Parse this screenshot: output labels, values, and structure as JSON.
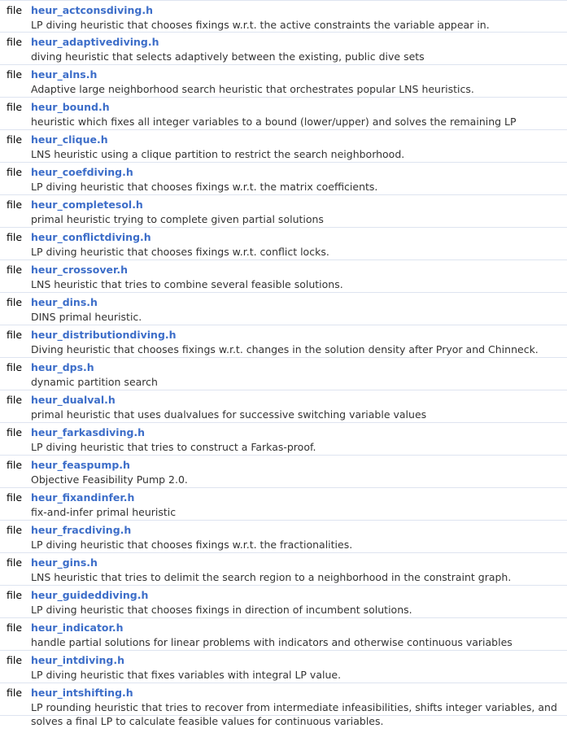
{
  "colors": {
    "link": "#3d6ec9",
    "text": "#333333",
    "divider": "#dee4f0",
    "background": "#ffffff"
  },
  "files": [
    {
      "kind": "file",
      "name": "heur_actconsdiving.h",
      "description": "LP diving heuristic that chooses fixings w.r.t. the active constraints the variable appear in."
    },
    {
      "kind": "file",
      "name": "heur_adaptivediving.h",
      "description": "diving heuristic that selects adaptively between the existing, public dive sets"
    },
    {
      "kind": "file",
      "name": "heur_alns.h",
      "description": "Adaptive large neighborhood search heuristic that orchestrates popular LNS heuristics."
    },
    {
      "kind": "file",
      "name": "heur_bound.h",
      "description": "heuristic which fixes all integer variables to a bound (lower/upper) and solves the remaining LP"
    },
    {
      "kind": "file",
      "name": "heur_clique.h",
      "description": "LNS heuristic using a clique partition to restrict the search neighborhood."
    },
    {
      "kind": "file",
      "name": "heur_coefdiving.h",
      "description": "LP diving heuristic that chooses fixings w.r.t. the matrix coefficients."
    },
    {
      "kind": "file",
      "name": "heur_completesol.h",
      "description": "primal heuristic trying to complete given partial solutions"
    },
    {
      "kind": "file",
      "name": "heur_conflictdiving.h",
      "description": "LP diving heuristic that chooses fixings w.r.t. conflict locks."
    },
    {
      "kind": "file",
      "name": "heur_crossover.h",
      "description": "LNS heuristic that tries to combine several feasible solutions."
    },
    {
      "kind": "file",
      "name": "heur_dins.h",
      "description": "DINS primal heuristic."
    },
    {
      "kind": "file",
      "name": "heur_distributiondiving.h",
      "description": "Diving heuristic that chooses fixings w.r.t. changes in the solution density after Pryor and Chinneck."
    },
    {
      "kind": "file",
      "name": "heur_dps.h",
      "description": "dynamic partition search"
    },
    {
      "kind": "file",
      "name": "heur_dualval.h",
      "description": "primal heuristic that uses dualvalues for successive switching variable values"
    },
    {
      "kind": "file",
      "name": "heur_farkasdiving.h",
      "description": "LP diving heuristic that tries to construct a Farkas-proof."
    },
    {
      "kind": "file",
      "name": "heur_feaspump.h",
      "description": "Objective Feasibility Pump 2.0."
    },
    {
      "kind": "file",
      "name": "heur_fixandinfer.h",
      "description": "fix-and-infer primal heuristic"
    },
    {
      "kind": "file",
      "name": "heur_fracdiving.h",
      "description": "LP diving heuristic that chooses fixings w.r.t. the fractionalities."
    },
    {
      "kind": "file",
      "name": "heur_gins.h",
      "description": "LNS heuristic that tries to delimit the search region to a neighborhood in the constraint graph."
    },
    {
      "kind": "file",
      "name": "heur_guideddiving.h",
      "description": "LP diving heuristic that chooses fixings in direction of incumbent solutions."
    },
    {
      "kind": "file",
      "name": "heur_indicator.h",
      "description": "handle partial solutions for linear problems with indicators and otherwise continuous variables"
    },
    {
      "kind": "file",
      "name": "heur_intdiving.h",
      "description": "LP diving heuristic that fixes variables with integral LP value."
    },
    {
      "kind": "file",
      "name": "heur_intshifting.h",
      "description": "LP rounding heuristic that tries to recover from intermediate infeasibilities, shifts integer variables, and solves a final LP to calculate feasible values for continuous variables."
    }
  ]
}
